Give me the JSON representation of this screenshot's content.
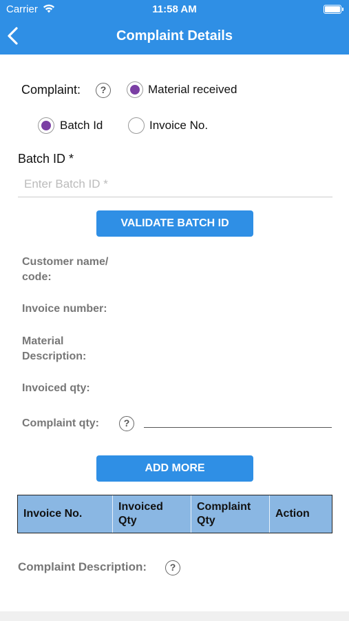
{
  "status": {
    "carrier": "Carrier",
    "time": "11:58 AM"
  },
  "header": {
    "title": "Complaint Details"
  },
  "complaint": {
    "label": "Complaint:",
    "option_material": "Material received",
    "option_batch": "Batch Id",
    "option_invoice": "Invoice No."
  },
  "batch": {
    "label": "Batch ID *",
    "placeholder": "Enter Batch ID *"
  },
  "buttons": {
    "validate": "VALIDATE BATCH ID",
    "add_more": "ADD MORE"
  },
  "info": {
    "customer": [
      "Customer name/",
      "code:"
    ],
    "invoice_number": "Invoice number:",
    "material_desc": [
      "Material",
      "Description:"
    ],
    "invoiced_qty": "Invoiced qty:",
    "complaint_qty": "Complaint qty:"
  },
  "table": {
    "headers": [
      [
        "Invoice No."
      ],
      [
        "Invoiced",
        "Qty"
      ],
      [
        "Complaint",
        "Qty"
      ],
      [
        "Action"
      ]
    ]
  },
  "description": {
    "label": "Complaint Description:"
  },
  "help_symbol": "?",
  "colors": {
    "accent": "#2f8fe5",
    "radio_selected": "#7b3fa4",
    "table_header": "#8ab7e3"
  }
}
